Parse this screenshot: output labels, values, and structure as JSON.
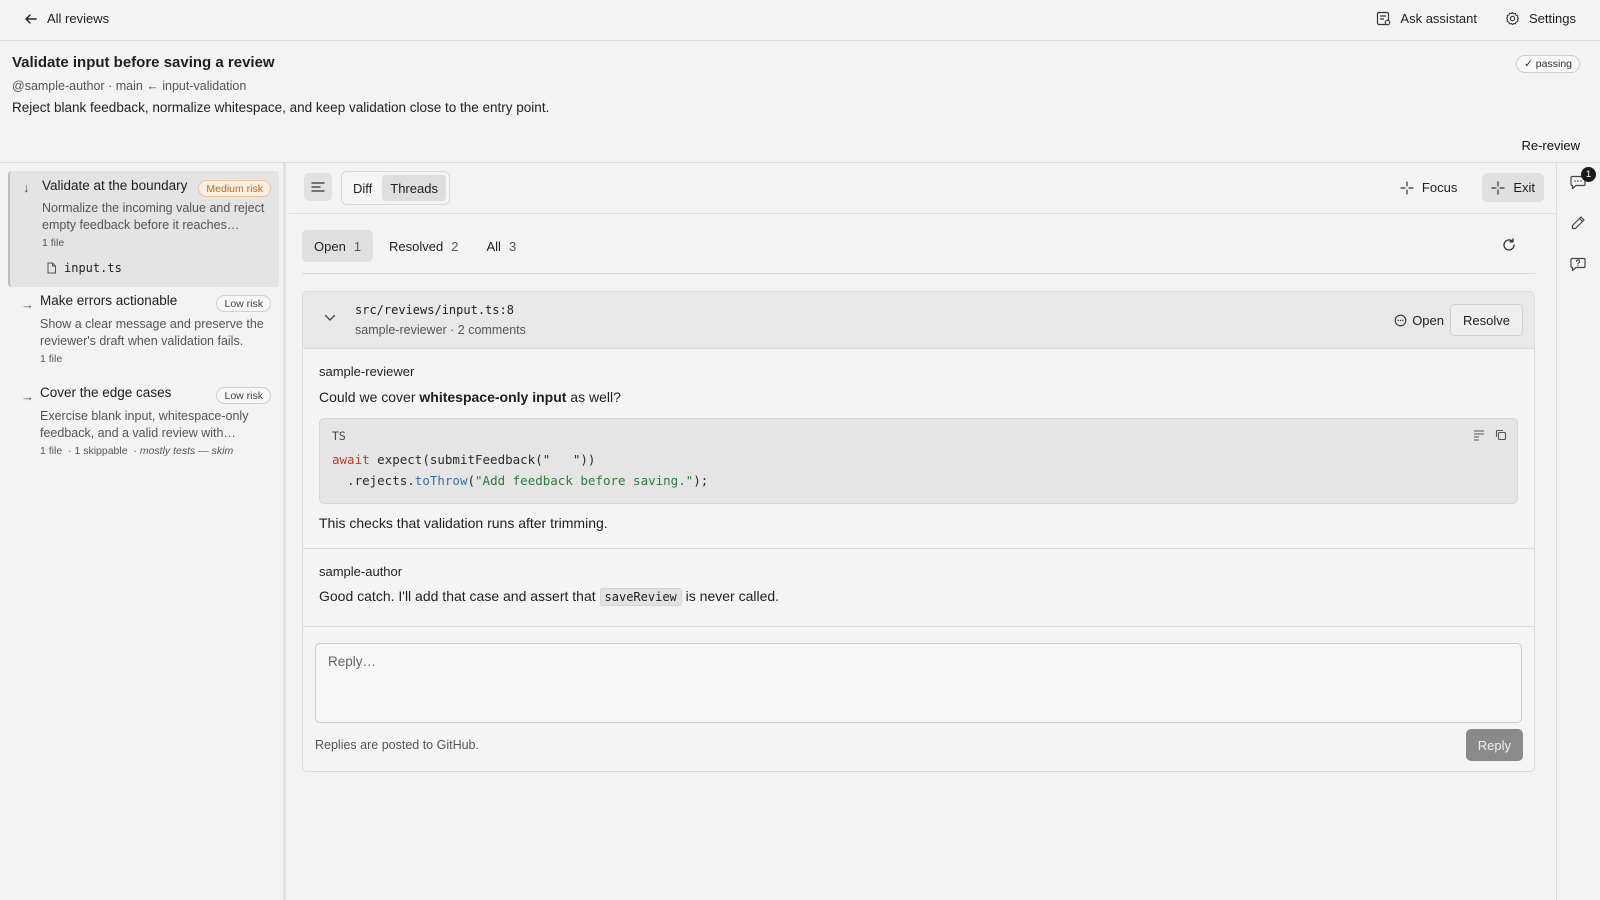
{
  "topbar": {
    "back_label": "All reviews",
    "assistant_label": "Ask assistant",
    "settings_label": "Settings"
  },
  "pr": {
    "title": "Validate input before saving a review",
    "meta": "@sample-author · main ← input-validation",
    "description": "Reject blank feedback, normalize whitespace, and keep validation close to the entry point.",
    "status": "✓ passing",
    "rereview_label": "Re-review"
  },
  "steps": [
    {
      "arrow": "↓",
      "title": "Validate at the boundary",
      "risk": "Medium risk",
      "description": "Normalize the incoming value and reject empty feedback before it reaches…",
      "files": "1 file",
      "file_name": "input.ts"
    },
    {
      "arrow": "→",
      "title": "Make errors actionable",
      "risk": "Low risk",
      "description": "Show a clear message and preserve the reviewer's draft when validation fails.",
      "files": "1 file"
    },
    {
      "arrow": "→",
      "title": "Cover the edge cases",
      "risk": "Low risk",
      "description": "Exercise blank input, whitespace-only feedback, and a valid review with…",
      "files": "1 file",
      "skippable": "· 1 skippable",
      "note_prefix": "·",
      "note": "mostly tests — skim"
    }
  ],
  "toolbar": {
    "tabs": [
      "Diff",
      "Threads"
    ],
    "active_tab": "Threads",
    "focus_label": "Focus",
    "exit_label": "Exit"
  },
  "filters": [
    {
      "label": "Open",
      "count": "1"
    },
    {
      "label": "Resolved",
      "count": "2"
    },
    {
      "label": "All",
      "count": "3"
    }
  ],
  "thread": {
    "path": "src/reviews/input.ts:8",
    "subtitle": "sample-reviewer · 2 comments",
    "status_label": "Open",
    "resolve_label": "Resolve",
    "comments": [
      {
        "author": "sample-reviewer",
        "text_before": "Could we cover ",
        "text_bold": "whitespace-only input",
        "text_after": " as well?",
        "code_lang": "TS",
        "code_line1_kw": "await",
        "code_line1_rest": " expect(submitFeedback(\"   \"))",
        "code_line2_pre": "  .rejects.",
        "code_line2_fn": "toThrow",
        "code_line2_open": "(",
        "code_line2_str": "\"Add feedback before saving.\"",
        "code_line2_close": ");",
        "text_followup": "This checks that validation runs after trimming."
      },
      {
        "author": "sample-author",
        "text_before": "Good catch. I'll add that case and assert that ",
        "code": "saveReview",
        "text_after": " is never called."
      }
    ],
    "reply_placeholder": "Reply…",
    "reply_note": "Replies are posted to GitHub.",
    "reply_label": "Reply"
  },
  "rail": {
    "badge_count": "1",
    "icons": [
      "comment-icon",
      "pencil-icon",
      "help-icon"
    ]
  },
  "colors": {
    "medium_risk": "#c06a14",
    "keyword": "#c0392b",
    "function": "#3b6ea5",
    "string": "#2f7a3b"
  }
}
